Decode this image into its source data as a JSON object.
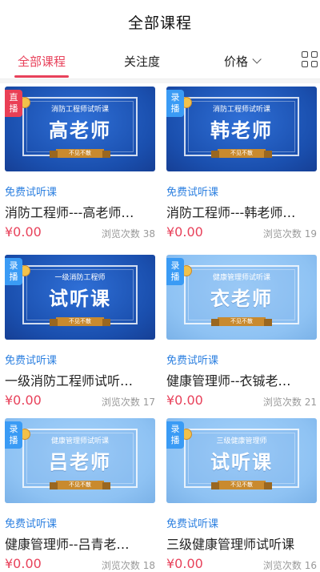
{
  "header": {
    "title": "全部课程"
  },
  "tabs": [
    {
      "label": "全部课程",
      "active": true
    },
    {
      "label": "关注度",
      "active": false
    },
    {
      "label": "价格",
      "active": false
    }
  ],
  "colors": {
    "accent": "#e8425b",
    "link": "#2b7fe0",
    "live_badge": "#ea3f55",
    "record_badge": "#3a9bf5"
  },
  "courses": [
    {
      "badge": "直播",
      "thumb_subtitle": "消防工程师试听课",
      "thumb_title": "高老师",
      "thumb_ribbon": "不见不散",
      "tag": "免费试听课",
      "name": "消防工程师---高老师…",
      "price": "¥0.00",
      "views": "浏览次数 38"
    },
    {
      "badge": "录播",
      "thumb_subtitle": "消防工程师试听课",
      "thumb_title": "韩老师",
      "thumb_ribbon": "不见不散",
      "tag": "免费试听课",
      "name": "消防工程师---韩老师…",
      "price": "¥0.00",
      "views": "浏览次数 19"
    },
    {
      "badge": "录播",
      "thumb_subtitle": "一级消防工程师",
      "thumb_title": "试听课",
      "thumb_ribbon": "不见不散",
      "tag": "免费试听课",
      "name": "一级消防工程师试听…",
      "price": "¥0.00",
      "views": "浏览次数 17"
    },
    {
      "badge": "录播",
      "thumb_subtitle": "健康管理师试听课",
      "thumb_title": "衣老师",
      "thumb_ribbon": "不见不散",
      "tag": "免费试听课",
      "name": "健康管理师--衣铖老…",
      "price": "¥0.00",
      "views": "浏览次数 21"
    },
    {
      "badge": "录播",
      "thumb_subtitle": "健康管理师试听课",
      "thumb_title": "吕老师",
      "thumb_ribbon": "不见不散",
      "tag": "免费试听课",
      "name": "健康管理师--吕青老…",
      "price": "¥0.00",
      "views": "浏览次数 18"
    },
    {
      "badge": "录播",
      "thumb_subtitle": "三级健康管理师",
      "thumb_title": "试听课",
      "thumb_ribbon": "不见不散",
      "tag": "免费试听课",
      "name": "三级健康管理师试听课",
      "price": "¥0.00",
      "views": "浏览次数 16"
    }
  ]
}
